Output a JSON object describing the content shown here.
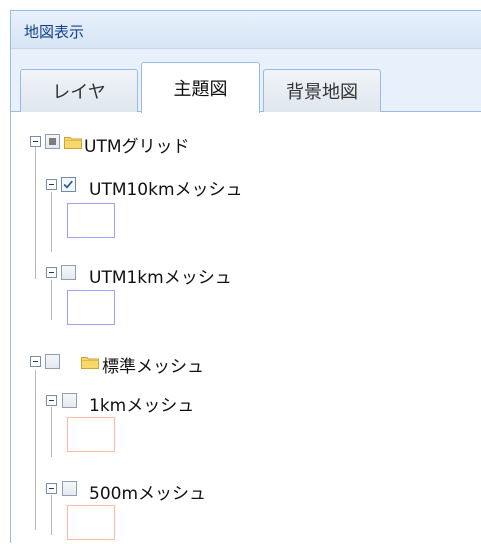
{
  "panel": {
    "title": "地図表示"
  },
  "tabs": [
    {
      "label": "レイヤ",
      "active": false
    },
    {
      "label": "主題図",
      "active": true
    },
    {
      "label": "背景地図",
      "active": false
    }
  ],
  "tree": {
    "groups": [
      {
        "label": "UTMグリッド",
        "check_state": "partial",
        "icon": "folder-icon",
        "expanded": true,
        "children": [
          {
            "label": "UTM10kmメッシュ",
            "checked": true,
            "legend_color": "#9da0ff"
          },
          {
            "label": "UTM1kmメッシュ",
            "checked": false,
            "legend_color": "#9da0ff"
          }
        ]
      },
      {
        "label": "標準メッシュ",
        "check_state": "unchecked",
        "icon": "folder-icon",
        "expanded": true,
        "children": [
          {
            "label": "1kmメッシュ",
            "checked": false,
            "legend_color": "#ffb8a8"
          },
          {
            "label": "500mメッシュ",
            "checked": false,
            "legend_color": "#ffb8a8"
          }
        ]
      }
    ]
  }
}
